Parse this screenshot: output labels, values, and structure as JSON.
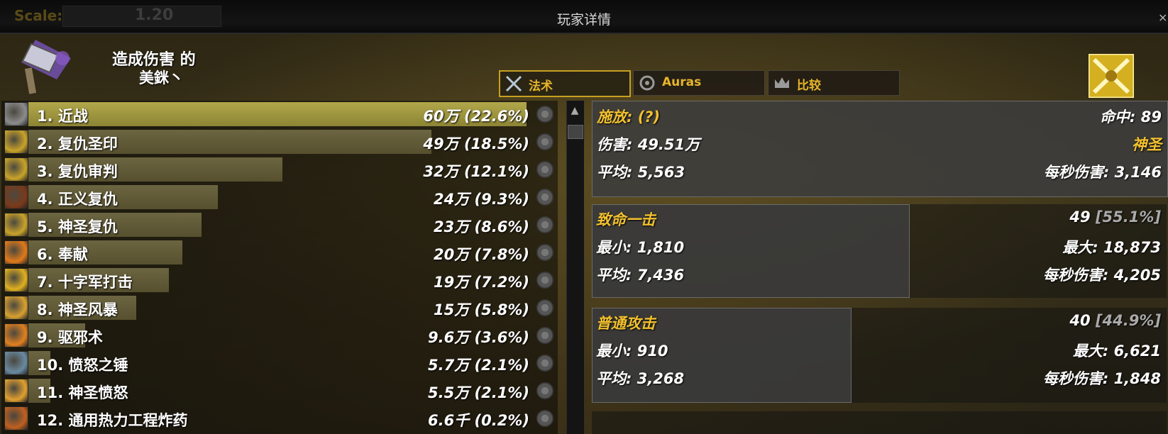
{
  "titlebar": {
    "scale_label": "Scale:",
    "scale_value": "1.20",
    "title": "玩家详情",
    "close": "×"
  },
  "header": {
    "title": "造成伤害 的",
    "player_name": "美銤丶",
    "icon": "hammer-icon",
    "class_icon": "retribution-paladin-icon"
  },
  "tabs": [
    {
      "label": "法术",
      "icon": "crossed-swords-icon",
      "active": true
    },
    {
      "label": "Auras",
      "icon": "aura-icon",
      "active": false
    },
    {
      "label": "比较",
      "icon": "crown-icon",
      "active": false
    }
  ],
  "spells": [
    {
      "rank": "1.",
      "name": "近战",
      "value": "60万 (22.6%)",
      "percent": 22.6,
      "icon": "sword-icon",
      "color": "#8c8c8c"
    },
    {
      "rank": "2.",
      "name": "复仇圣印",
      "value": "49万 (18.5%)",
      "percent": 18.5,
      "icon": "seal-icon",
      "color": "#c9a32a"
    },
    {
      "rank": "3.",
      "name": "复仇审判",
      "value": "32万 (12.1%)",
      "percent": 12.1,
      "icon": "judgement-icon",
      "color": "#c9a32a"
    },
    {
      "rank": "4.",
      "name": "正义复仇",
      "value": "24万 (9.3%)",
      "percent": 9.3,
      "icon": "vengeance-icon",
      "color": "#7a3a1a"
    },
    {
      "rank": "5.",
      "name": "神圣复仇",
      "value": "23万 (8.6%)",
      "percent": 8.6,
      "icon": "holy-vengeance-icon",
      "color": "#c9a32a"
    },
    {
      "rank": "6.",
      "name": "奉献",
      "value": "20万 (7.8%)",
      "percent": 7.8,
      "icon": "consecration-icon",
      "color": "#e07a1a"
    },
    {
      "rank": "7.",
      "name": "十字军打击",
      "value": "19万 (7.2%)",
      "percent": 7.2,
      "icon": "crusader-strike-icon",
      "color": "#e0b020"
    },
    {
      "rank": "8.",
      "name": "神圣风暴",
      "value": "15万 (5.8%)",
      "percent": 5.8,
      "icon": "divine-storm-icon",
      "color": "#d8a030"
    },
    {
      "rank": "9.",
      "name": "驱邪术",
      "value": "9.6万 (3.6%)",
      "percent": 3.6,
      "icon": "exorcism-icon",
      "color": "#e08020"
    },
    {
      "rank": "10.",
      "name": "愤怒之锤",
      "value": "5.7万 (2.1%)",
      "percent": 2.1,
      "icon": "hammer-of-wrath-icon",
      "color": "#6a8aa0"
    },
    {
      "rank": "11.",
      "name": "神圣愤怒",
      "value": "5.5万 (2.1%)",
      "percent": 2.1,
      "icon": "holy-wrath-icon",
      "color": "#e0a030"
    },
    {
      "rank": "12.",
      "name": "通用热力工程炸药",
      "value": "6.6千 (0.2%)",
      "percent": 0.2,
      "icon": "explosive-icon",
      "color": "#c06020"
    }
  ],
  "detail": {
    "summary": {
      "cast_label": "施放: (?)",
      "hits": "命中: 89",
      "damage": "伤害: 49.51万",
      "school": "神圣",
      "average": "平均: 5,563",
      "dps": "每秒伤害: 3,146"
    },
    "critical": {
      "title": "致命一击",
      "count": "49 ",
      "percent": "[55.1%]",
      "ratio": 0.551,
      "min": "最小: 1,810",
      "max": "最大: 18,873",
      "average": "平均: 7,436",
      "dps": "每秒伤害: 4,205"
    },
    "normal": {
      "title": "普通攻击",
      "count": "40 ",
      "percent": "[44.9%]",
      "ratio": 0.449,
      "min": "最小: 910",
      "max": "最大: 6,621",
      "average": "平均: 3,268",
      "dps": "每秒伤害: 1,848"
    }
  }
}
